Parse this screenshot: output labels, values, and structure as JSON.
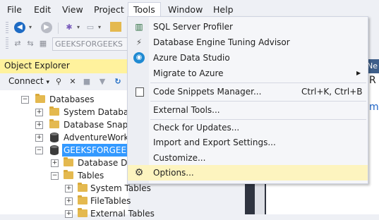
{
  "menubar": {
    "items": [
      "File",
      "Edit",
      "View",
      "Project",
      "Tools",
      "Window",
      "Help"
    ]
  },
  "toolbar": {
    "server_dropdown": "GEEKSFORGEEKS"
  },
  "object_explorer": {
    "title": "Object Explorer",
    "connect_label": "Connect",
    "connect_arrow": "▾",
    "tree": {
      "databases": "Databases",
      "system_databases": "System Database",
      "database_snapshots": "Database Snapsh",
      "adventureworks": "AdventureWorks2",
      "geeksforgeeks": "GEEKSFORGEEKS",
      "database_diagrams": "Database Diag",
      "tables": "Tables",
      "system_tables": "System Tables",
      "filetables": "FileTables",
      "external_tables": "External Tables"
    }
  },
  "right_pane": {
    "tab_fragment": "Ne",
    "text1": "R",
    "text2": "m"
  },
  "tools_menu": {
    "items": [
      {
        "label": "SQL Server Profiler",
        "icon": "profiler-icon"
      },
      {
        "label": "Database Engine Tuning Advisor",
        "icon": "tuning-advisor-icon"
      },
      {
        "label": "Azure Data Studio",
        "icon": "azure-data-studio-icon"
      },
      {
        "label": "Migrate to Azure",
        "submenu": true
      },
      {
        "label": "Code Snippets Manager...",
        "shortcut": "Ctrl+K, Ctrl+B",
        "icon": "snippets-icon"
      },
      {
        "label": "External Tools..."
      },
      {
        "label": "Check for Updates..."
      },
      {
        "label": "Import and Export Settings..."
      },
      {
        "label": "Customize..."
      },
      {
        "label": "Options...",
        "icon": "gear-icon",
        "highlighted": true
      }
    ]
  },
  "colors": {
    "highlight": "#fdf4bf",
    "selection": "#3399ff",
    "oe_header": "#fff29d"
  }
}
